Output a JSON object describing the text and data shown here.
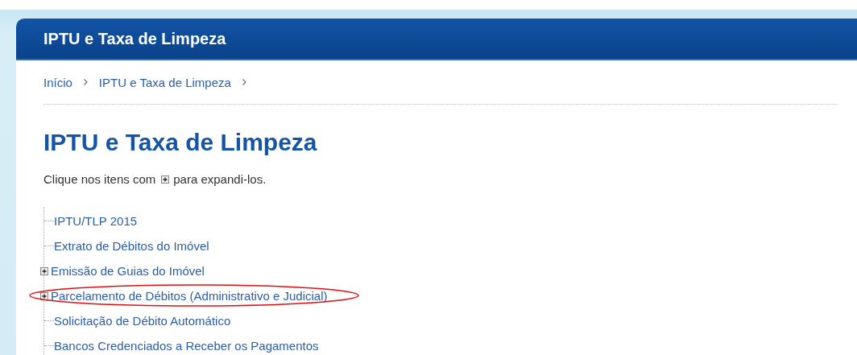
{
  "header": {
    "title": "IPTU e Taxa de Limpeza"
  },
  "breadcrumb": [
    "Início",
    "IPTU e Taxa de Limpeza"
  ],
  "page_title": "IPTU e Taxa de Limpeza",
  "instruction": {
    "before": "Clique nos itens com",
    "after": "para expandi-los."
  },
  "tree": [
    {
      "label": "IPTU/TLP 2015",
      "expandable": false,
      "highlighted": false
    },
    {
      "label": "Extrato de Débitos do Imóvel",
      "expandable": false,
      "highlighted": false
    },
    {
      "label": "Emissão de Guias do Imóvel",
      "expandable": true,
      "highlighted": false
    },
    {
      "label": "Parcelamento de Débitos (Administrativo e Judicial)",
      "expandable": true,
      "highlighted": true
    },
    {
      "label": "Solicitação de Débito Automático",
      "expandable": false,
      "highlighted": false
    },
    {
      "label": "Bancos Credenciados a Receber os Pagamentos",
      "expandable": false,
      "highlighted": false
    }
  ]
}
